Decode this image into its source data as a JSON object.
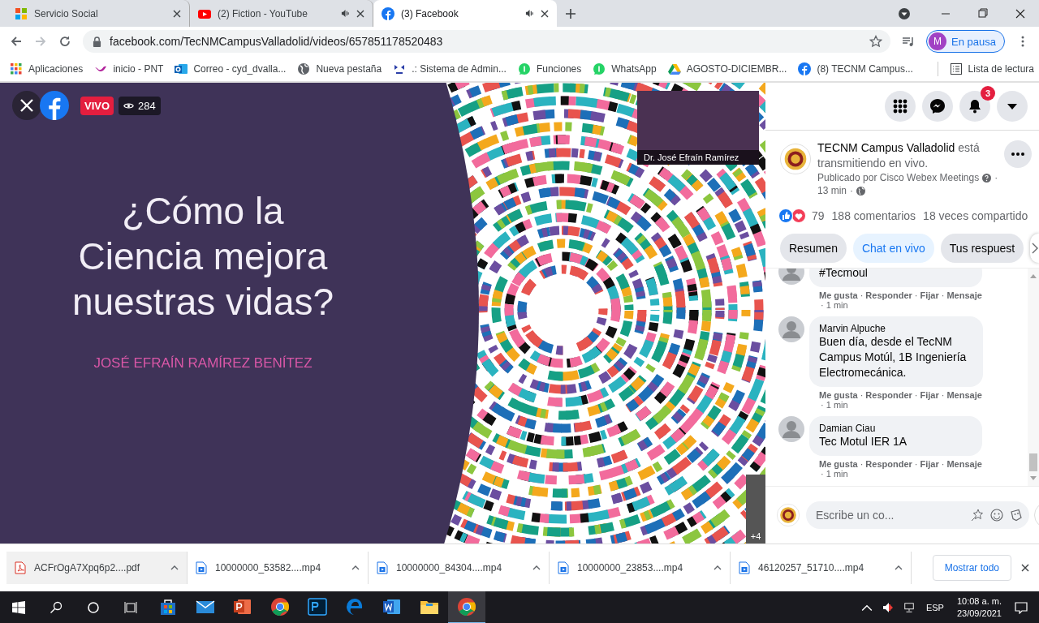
{
  "browser": {
    "tabs": [
      {
        "title": "Servicio Social",
        "kind": "grid",
        "audio": false,
        "selected": false
      },
      {
        "title": "(2) Fiction - YouTube",
        "kind": "youtube",
        "audio": true,
        "selected": false
      },
      {
        "title": "(3) Facebook",
        "kind": "facebook",
        "audio": true,
        "selected": true
      }
    ],
    "address": "facebook.com/TecNMCampusValladolid/videos/657851178520483",
    "profile": {
      "initial": "M",
      "status": "En pausa"
    },
    "bookmarks": [
      {
        "kind": "apps",
        "label": "Aplicaciones"
      },
      {
        "kind": "pnt",
        "label": "inicio - PNT"
      },
      {
        "kind": "outlook",
        "label": "Correo - cyd_dvalla..."
      },
      {
        "kind": "globe",
        "label": "Nueva pestaña"
      },
      {
        "kind": "saga",
        "label": ".: Sistema de Admin..."
      },
      {
        "kind": "whatsapp",
        "label": "Funciones"
      },
      {
        "kind": "whatsapp",
        "label": "WhatsApp"
      },
      {
        "kind": "drive",
        "label": "AGOSTO-DICIEMBR..."
      },
      {
        "kind": "facebook",
        "label": "(8) TECNM Campus..."
      }
    ],
    "reading_list": "Lista de lectura"
  },
  "video": {
    "live_badge": "VIVO",
    "viewers": "284",
    "slide": {
      "title": "¿Cómo la Ciencia mejora nuestras vidas?",
      "author": "JOSÉ EFRAÍN RAMÍREZ BENÍTEZ"
    },
    "speaker_caption": "Dr. José Efraín Ramírez",
    "more_count": "+4"
  },
  "facebook_nav": {
    "notifications": "3"
  },
  "post": {
    "header": "**TECNM Campus Valladolid** está transmitiendo en vivo.",
    "published_by": "Publicado por Cisco Webex Meetings",
    "time": "13 min",
    "separator": "·",
    "reactions": "79",
    "comments": "188 comentarios",
    "shares": "18 veces compartido",
    "tabs": [
      {
        "label": "Resumen",
        "selected": false
      },
      {
        "label": "Chat en vivo",
        "selected": true
      },
      {
        "label": "Tus respuest",
        "selected": false
      }
    ]
  },
  "comments": [
    {
      "text": "#Tecmoul",
      "actions": [
        "Me gusta",
        "Responder",
        "Fijar",
        "Mensaje"
      ],
      "time": "1 min"
    },
    {
      "author": "Marvin Alpuche",
      "text": "Buen día, desde el TecNM Campus Motúl, 1B Ingeniería Electromecánica.",
      "actions": [
        "Me gusta",
        "Responder",
        "Fijar",
        "Mensaje"
      ],
      "time": "1 min"
    },
    {
      "author": "Damian Ciau",
      "text": "Tec Motul IER 1A",
      "actions": [
        "Me gusta",
        "Responder",
        "Fijar",
        "Mensaje"
      ],
      "time": "1 min"
    }
  ],
  "comment_box": {
    "placeholder": "Escribe un co..."
  },
  "downloads": {
    "items": [
      {
        "kind": "pdf",
        "name": "ACFrOgA7Xpq6p2....pdf"
      },
      {
        "kind": "video",
        "name": "10000000_53582....mp4"
      },
      {
        "kind": "video",
        "name": "10000000_84304....mp4"
      },
      {
        "kind": "video",
        "name": "10000000_23853....mp4"
      },
      {
        "kind": "video",
        "name": "46120257_51710....mp4"
      }
    ],
    "show_all": "Mostrar todo"
  },
  "taskbar": {
    "apps": [
      {
        "kind": "store",
        "active": false
      },
      {
        "kind": "mail",
        "active": false
      },
      {
        "kind": "powerpoint",
        "active": false
      },
      {
        "kind": "chrome",
        "active": false
      },
      {
        "kind": "photoshop",
        "active": false
      },
      {
        "kind": "edge",
        "active": false
      },
      {
        "kind": "word",
        "active": false
      },
      {
        "kind": "explorer",
        "active": false
      },
      {
        "kind": "chrome",
        "active": true
      }
    ],
    "language": "ESP",
    "time": "10:08 a. m.",
    "date": "23/09/2021"
  }
}
